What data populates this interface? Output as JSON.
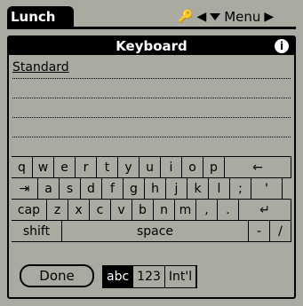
{
  "app_tab": "Lunch",
  "menu": {
    "label": "Menu"
  },
  "window": {
    "title": "Keyboard",
    "info_glyph": "i"
  },
  "text_field": {
    "value": "Standard"
  },
  "keyboard": {
    "row1": [
      "q",
      "w",
      "e",
      "r",
      "t",
      "y",
      "u",
      "i",
      "o",
      "p",
      "←"
    ],
    "row2": [
      "⇥",
      "a",
      "s",
      "d",
      "f",
      "g",
      "h",
      "j",
      "k",
      "l",
      ";",
      "'"
    ],
    "row3": [
      "cap",
      "z",
      "x",
      "c",
      "v",
      "b",
      "n",
      "m",
      ",",
      ".",
      "↵"
    ],
    "row4": [
      "shift",
      "space",
      "-",
      "/"
    ]
  },
  "bottom": {
    "done_label": "Done",
    "modes": [
      "abc",
      "123",
      "Int'l"
    ],
    "active_mode": "abc"
  }
}
